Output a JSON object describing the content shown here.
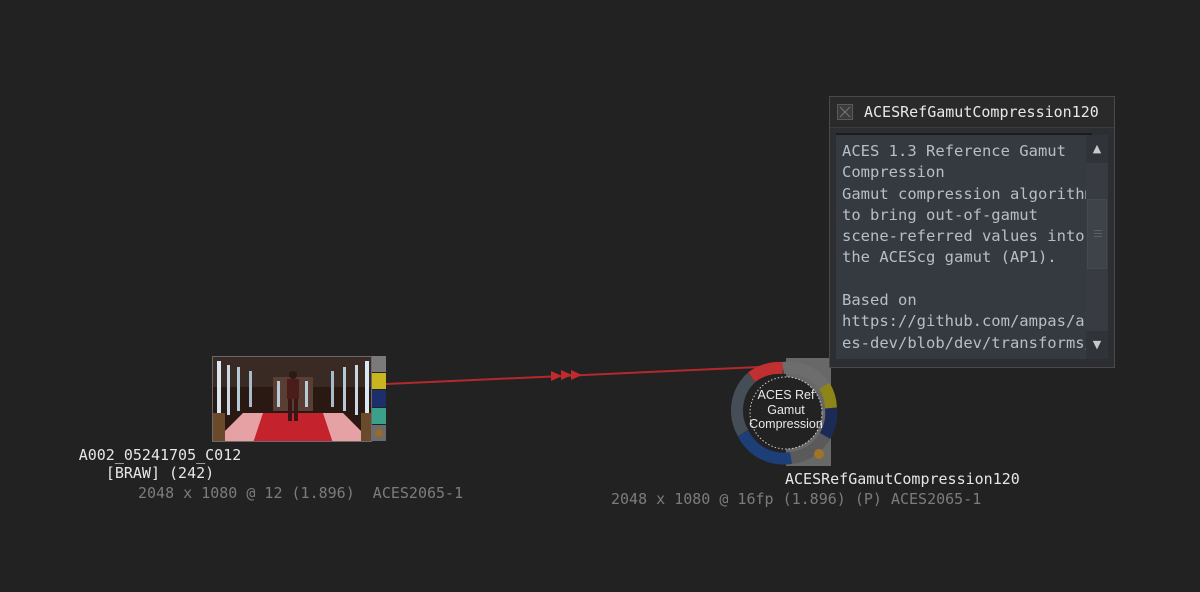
{
  "source_node": {
    "name_line1": "A002_05241705_C012",
    "name_line2": "[BRAW] (242)",
    "meta": "2048 x 1080 @ 12 (1.896)  ACES2065-1",
    "port_colors": [
      "#7a7a7a",
      "#c9b51d",
      "#1d2f6a",
      "#3aa08a",
      "#6b6b6b"
    ]
  },
  "effect_node": {
    "label": "ACES Ref Gamut Compression",
    "label_lines": [
      "ACES Ref",
      "Gamut",
      "Compression"
    ],
    "name": "ACESRefGamutCompression120",
    "meta": "2048 x 1080 @ 16fp (1.896) (P) ACES2065-1"
  },
  "connection": {
    "color": "#b3292c"
  },
  "info_panel": {
    "title": "ACESRefGamutCompression120",
    "description": "ACES 1.3 Reference Gamut\nCompression\nGamut compression algorithm\nto bring out-of-gamut\nscene-referred values into\nthe ACEScg gamut (AP1).\n\nBased on\nhttps://github.com/ampas/ac\nes-dev/blob/dev/transforms/",
    "scroll_up_icon": "triangle-up",
    "scroll_down_icon": "triangle-down"
  }
}
